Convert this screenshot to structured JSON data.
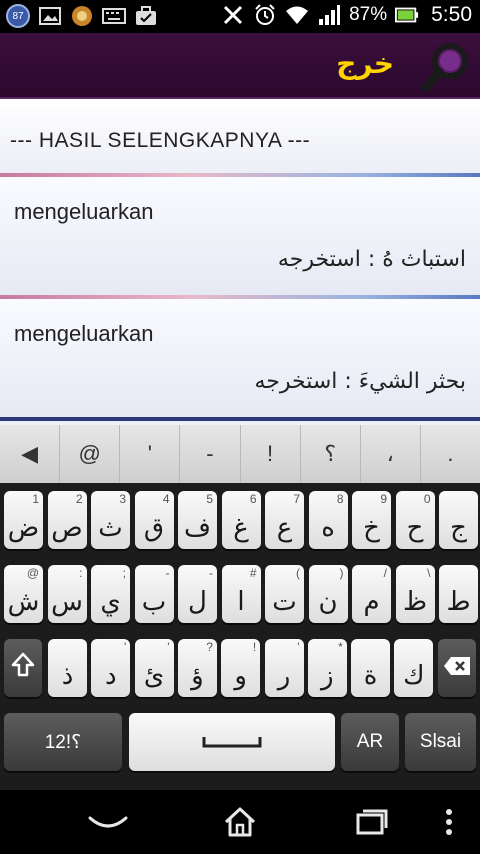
{
  "status_bar": {
    "notification_count": "87",
    "battery_percent": "87%",
    "time": "5:50",
    "icons": [
      "badge-87-icon",
      "image-icon",
      "circle-app-icon",
      "keyboard-icon",
      "briefcase-icon",
      "mute-icon",
      "alarm-icon",
      "wifi-icon",
      "signal-icon",
      "battery-icon"
    ]
  },
  "app_bar": {
    "title": "خرج",
    "search_icon": "search-icon",
    "accent_color": "#ffd400",
    "bg_color": "#3b0f3c"
  },
  "results": {
    "header": "--- HASIL SELENGKAPNYA ---",
    "items": [
      {
        "word": "mengeluarkan",
        "arabic": "استباث هُ  :  استخرجه"
      },
      {
        "word": "mengeluarkan",
        "arabic": "بحثر الشيءَ  :  استخرجه"
      }
    ]
  },
  "keyboard": {
    "symbols": [
      "◀",
      "@",
      "'",
      "-",
      "!",
      "؟",
      "،",
      "."
    ],
    "row1": [
      {
        "main": "ض",
        "hint": "1"
      },
      {
        "main": "ص",
        "hint": "2"
      },
      {
        "main": "ث",
        "hint": "3"
      },
      {
        "main": "ق",
        "hint": "4"
      },
      {
        "main": "ف",
        "hint": "5"
      },
      {
        "main": "غ",
        "hint": "6"
      },
      {
        "main": "ع",
        "hint": "7"
      },
      {
        "main": "ه",
        "hint": "8"
      },
      {
        "main": "خ",
        "hint": "9"
      },
      {
        "main": "ح",
        "hint": "0"
      },
      {
        "main": "ج",
        "hint": ""
      }
    ],
    "row2": [
      {
        "main": "ش",
        "hint": "@"
      },
      {
        "main": "س",
        "hint": ":"
      },
      {
        "main": "ي",
        "hint": ";"
      },
      {
        "main": "ب",
        "hint": "-"
      },
      {
        "main": "ل",
        "hint": "-"
      },
      {
        "main": "ا",
        "hint": "#"
      },
      {
        "main": "ت",
        "hint": "("
      },
      {
        "main": "ن",
        "hint": ")"
      },
      {
        "main": "م",
        "hint": "/"
      },
      {
        "main": "ظ",
        "hint": "\\"
      },
      {
        "main": "ط",
        "hint": ""
      }
    ],
    "row3": [
      {
        "main": "ذ",
        "hint": ""
      },
      {
        "main": "د",
        "hint": "'"
      },
      {
        "main": "ئ",
        "hint": "'"
      },
      {
        "main": "ؤ",
        "hint": "?"
      },
      {
        "main": "و",
        "hint": "!"
      },
      {
        "main": "ر",
        "hint": "'"
      },
      {
        "main": "ز",
        "hint": "*"
      },
      {
        "main": "ة",
        "hint": ""
      },
      {
        "main": "ك",
        "hint": ""
      }
    ],
    "shift_icon": "shift-icon",
    "backspace_icon": "backspace-icon",
    "symbols_key": "؟!12",
    "space_icon": "space-icon",
    "language_key": "AR",
    "next_key": "Slsai"
  },
  "nav_bar": {
    "back_icon": "back-icon",
    "home_icon": "home-icon",
    "recents_icon": "recents-icon",
    "menu_icon": "menu-icon"
  }
}
